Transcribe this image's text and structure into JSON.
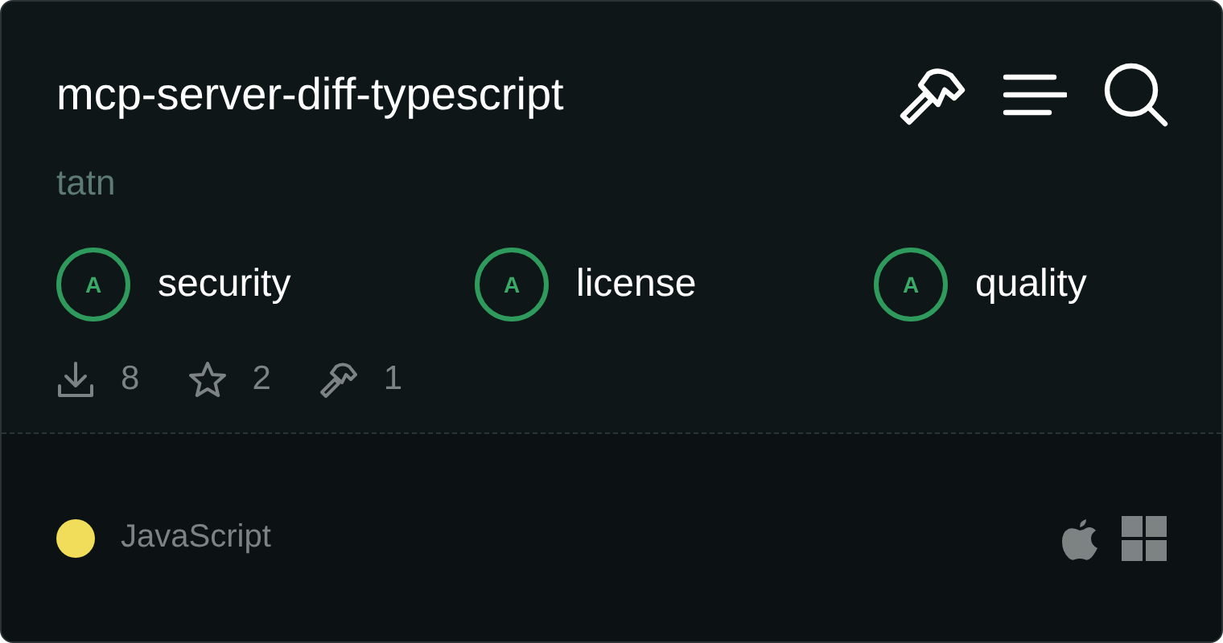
{
  "title": "mcp-server-diff-typescript",
  "author": "tatn",
  "grades": [
    {
      "grade": "A",
      "label": "security"
    },
    {
      "grade": "A",
      "label": "license"
    },
    {
      "grade": "A",
      "label": "quality"
    }
  ],
  "stats": [
    {
      "kind": "downloads",
      "value": "8"
    },
    {
      "kind": "stars",
      "value": "2"
    },
    {
      "kind": "tools",
      "value": "1"
    }
  ],
  "language": {
    "name": "JavaScript",
    "color": "#f1dd59"
  }
}
